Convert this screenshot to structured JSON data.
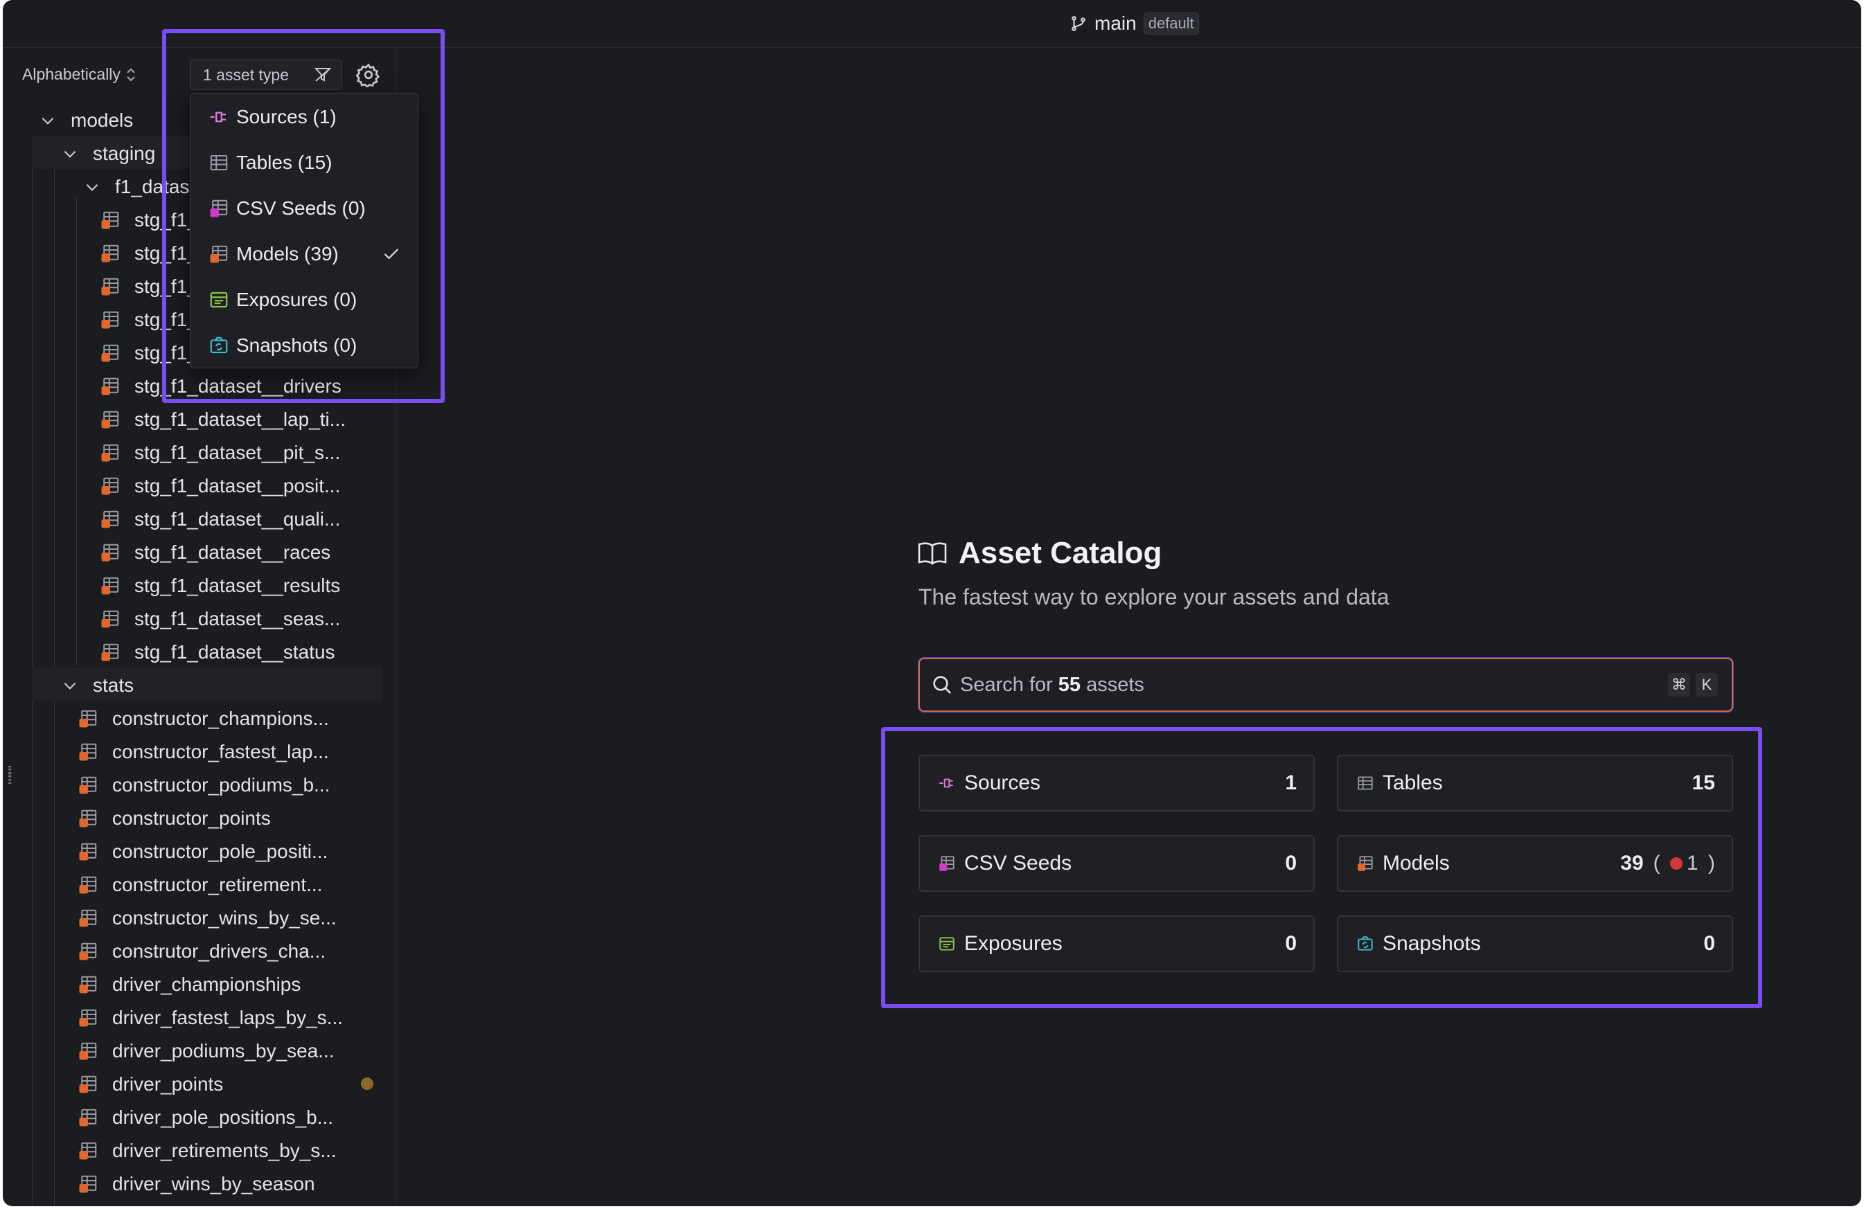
{
  "header": {
    "branch": "main",
    "branch_tag": "default"
  },
  "sidebar": {
    "sort_label": "Alphabetically",
    "filter_label": "1 asset type",
    "tree": {
      "models": "models",
      "staging": "staging",
      "f1_dataset": "f1_datas",
      "staging_items": [
        "stg_f1_",
        "stg_f1_",
        "stg_f1_",
        "stg_f1_",
        "stg_f1_",
        "stg_f1_dataset__drivers",
        "stg_f1_dataset__lap_ti...",
        "stg_f1_dataset__pit_s...",
        "stg_f1_dataset__posit...",
        "stg_f1_dataset__quali...",
        "stg_f1_dataset__races",
        "stg_f1_dataset__results",
        "stg_f1_dataset__seas...",
        "stg_f1_dataset__status"
      ],
      "stats": "stats",
      "stats_items": [
        "constructor_champions...",
        "constructor_fastest_lap...",
        "constructor_podiums_b...",
        "constructor_points",
        "constructor_pole_positi...",
        "constructor_retirement...",
        "constructor_wins_by_se...",
        "construtor_drivers_cha...",
        "driver_championships",
        "driver_fastest_laps_by_s...",
        "driver_podiums_by_sea...",
        "driver_points",
        "driver_pole_positions_b...",
        "driver_retirements_by_s...",
        "driver_wins_by_season"
      ]
    }
  },
  "dropdown": {
    "items": [
      {
        "label": "Sources (1)",
        "icon": "source-icon",
        "checked": false
      },
      {
        "label": "Tables (15)",
        "icon": "table-icon",
        "checked": false
      },
      {
        "label": "CSV Seeds (0)",
        "icon": "seed-icon",
        "checked": false
      },
      {
        "label": "Models (39)",
        "icon": "model-icon",
        "checked": true
      },
      {
        "label": "Exposures (0)",
        "icon": "exposure-icon",
        "checked": false
      },
      {
        "label": "Snapshots (0)",
        "icon": "snapshot-icon",
        "checked": false
      }
    ]
  },
  "main": {
    "title": "Asset Catalog",
    "subtitle": "The fastest way to explore your assets and data",
    "search": {
      "prefix": "Search for",
      "count": "55",
      "suffix": "assets",
      "shortcut_1": "⌘",
      "shortcut_2": "K"
    },
    "cards": [
      {
        "label": "Sources",
        "count": "1"
      },
      {
        "label": "Tables",
        "count": "15"
      },
      {
        "label": "CSV Seeds",
        "count": "0"
      },
      {
        "label": "Models",
        "count": "39",
        "errors": "1"
      },
      {
        "label": "Exposures",
        "count": "0"
      },
      {
        "label": "Snapshots",
        "count": "0"
      }
    ]
  },
  "colors": {
    "accent_highlight": "#7b4df0",
    "model_icon": "#e0682e",
    "error_dot": "#d23838",
    "search_border": "#c86d3c"
  }
}
